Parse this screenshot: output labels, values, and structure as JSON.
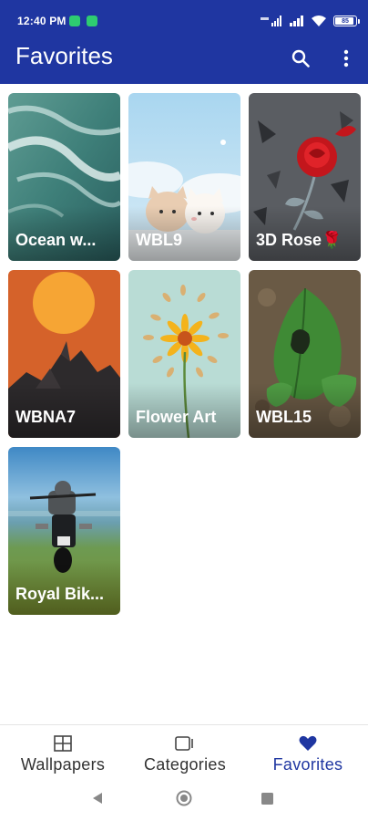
{
  "status": {
    "time": "12:40 PM",
    "battery": "85"
  },
  "header": {
    "title": "Favorites"
  },
  "icons": {
    "search": "search-icon",
    "more": "more-vertical-icon",
    "wallpapers": "grid-icon",
    "categories": "categories-icon",
    "favorites": "heart-icon"
  },
  "colors": {
    "primary": "#1f36a1",
    "nav_inactive": "#333333"
  },
  "wallpapers": [
    {
      "label": "Ocean w..."
    },
    {
      "label": "WBL9"
    },
    {
      "label": "3D Rose🌹"
    },
    {
      "label": "WBNA7"
    },
    {
      "label": "Flower Art"
    },
    {
      "label": "WBL15"
    },
    {
      "label": "Royal Bik..."
    }
  ],
  "bottom_nav": [
    {
      "label": "Wallpapers"
    },
    {
      "label": "Categories"
    },
    {
      "label": "Favorites"
    }
  ]
}
